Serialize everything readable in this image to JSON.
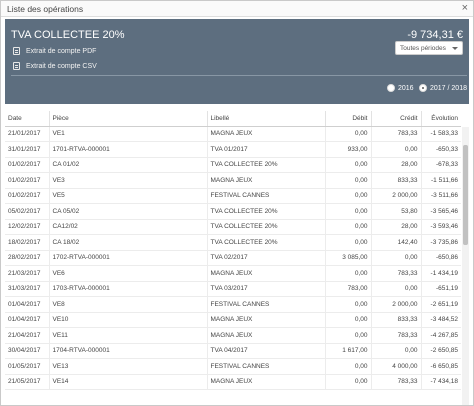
{
  "window": {
    "title": "Liste des opérations",
    "close_label": "×"
  },
  "header": {
    "title": "TVA COLLECTEE 20%",
    "amount": "-9 734,31 €",
    "links": [
      "Extrait de compte PDF",
      "Extrait de compte CSV"
    ],
    "period_select": "Toutes périodes",
    "radios": [
      {
        "label": "2016",
        "selected": false
      },
      {
        "label": "2017 / 2018",
        "selected": true
      }
    ]
  },
  "table": {
    "columns": [
      "Date",
      "Pièce",
      "Libellé",
      "Débit",
      "Crédit",
      "Évolution"
    ],
    "rows": [
      [
        "21/01/2017",
        "VE1",
        "MAGNA JEUX",
        "0,00",
        "783,33",
        "-1 583,33"
      ],
      [
        "31/01/2017",
        "1701-RTVA-000001",
        "TVA 01/2017",
        "933,00",
        "0,00",
        "-650,33"
      ],
      [
        "01/02/2017",
        "CA 01/02",
        "TVA COLLECTEE 20%",
        "0,00",
        "28,00",
        "-678,33"
      ],
      [
        "01/02/2017",
        "VE3",
        "MAGNA JEUX",
        "0,00",
        "833,33",
        "-1 511,66"
      ],
      [
        "01/02/2017",
        "VE5",
        "FESTIVAL CANNES",
        "0,00",
        "2 000,00",
        "-3 511,66"
      ],
      [
        "05/02/2017",
        "CA 05/02",
        "TVA COLLECTEE 20%",
        "0,00",
        "53,80",
        "-3 565,46"
      ],
      [
        "12/02/2017",
        "CA12/02",
        "TVA COLLECTEE 20%",
        "0,00",
        "28,00",
        "-3 593,46"
      ],
      [
        "18/02/2017",
        "CA 18/02",
        "TVA COLLECTEE 20%",
        "0,00",
        "142,40",
        "-3 735,86"
      ],
      [
        "28/02/2017",
        "1702-RTVA-000001",
        "TVA 02/2017",
        "3 085,00",
        "0,00",
        "-650,86"
      ],
      [
        "21/03/2017",
        "VE6",
        "MAGNA JEUX",
        "0,00",
        "783,33",
        "-1 434,19"
      ],
      [
        "31/03/2017",
        "1703-RTVA-000001",
        "TVA 03/2017",
        "783,00",
        "0,00",
        "-651,19"
      ],
      [
        "01/04/2017",
        "VE8",
        "FESTIVAL CANNES",
        "0,00",
        "2 000,00",
        "-2 651,19"
      ],
      [
        "01/04/2017",
        "VE10",
        "MAGNA JEUX",
        "0,00",
        "833,33",
        "-3 484,52"
      ],
      [
        "21/04/2017",
        "VE11",
        "MAGNA JEUX",
        "0,00",
        "783,33",
        "-4 267,85"
      ],
      [
        "30/04/2017",
        "1704-RTVA-000001",
        "TVA 04/2017",
        "1 617,00",
        "0,00",
        "-2 650,85"
      ],
      [
        "01/05/2017",
        "VE13",
        "FESTIVAL CANNES",
        "0,00",
        "4 000,00",
        "-6 650,85"
      ],
      [
        "21/05/2017",
        "VE14",
        "MAGNA JEUX",
        "0,00",
        "783,33",
        "-7 434,18"
      ]
    ]
  },
  "colors": {
    "header_bg": "#5d6e7f"
  }
}
